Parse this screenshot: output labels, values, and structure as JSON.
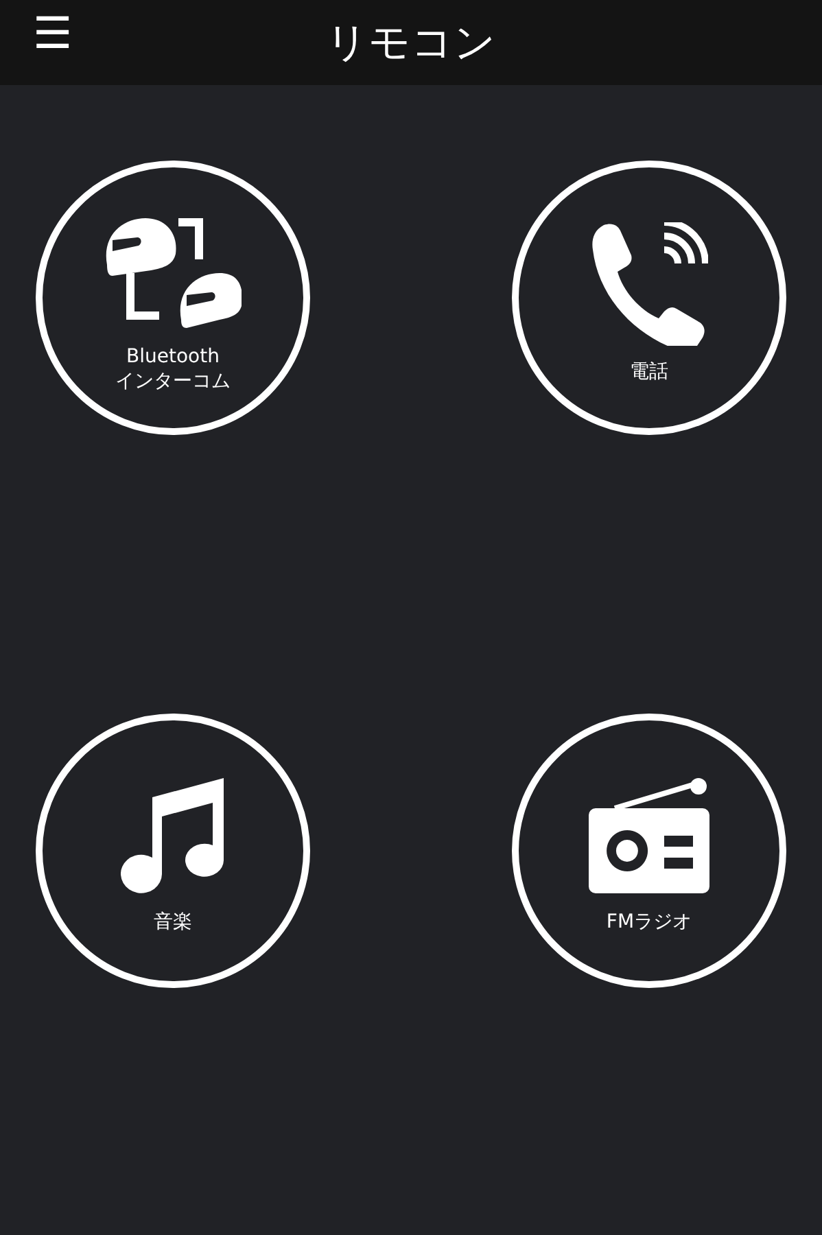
{
  "header": {
    "menu_icon": "☰",
    "title": "リモコン"
  },
  "buttons": [
    {
      "kind": "intercom",
      "label_lines": [
        "Bluetooth",
        "インターコム"
      ]
    },
    {
      "kind": "phone",
      "label_lines": [
        "電話"
      ]
    },
    {
      "kind": "music",
      "label_lines": [
        "音楽"
      ]
    },
    {
      "kind": "radio",
      "label_lines": [
        "FMラジオ"
      ]
    }
  ]
}
